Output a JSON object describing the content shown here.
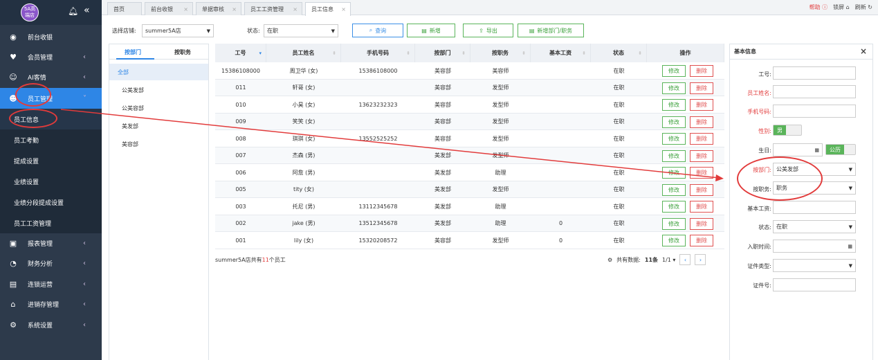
{
  "sidebar": {
    "logo_line1": "5A高",
    "logo_line2": "端店",
    "nav": [
      {
        "label": "前台收银",
        "icon": "cashier-icon"
      },
      {
        "label": "会员管理",
        "icon": "heart-icon"
      },
      {
        "label": "AI客情",
        "icon": "users-icon"
      },
      {
        "label": "员工管理",
        "icon": "user-icon"
      }
    ],
    "sub": [
      "员工信息",
      "员工考勤",
      "提成设置",
      "业绩设置",
      "业绩分段提成设置",
      "员工工资管理"
    ],
    "nav2": [
      {
        "label": "报表管理",
        "icon": "monitor-icon"
      },
      {
        "label": "财务分析",
        "icon": "pie-icon"
      },
      {
        "label": "连锁运营",
        "icon": "building-icon"
      },
      {
        "label": "进销存管理",
        "icon": "home-icon"
      },
      {
        "label": "系统设置",
        "icon": "gear-icon"
      }
    ]
  },
  "tabs": [
    "首页",
    "前台收银",
    "单据审核",
    "员工工资管理",
    "员工信息"
  ],
  "topright": {
    "help": "帮助",
    "lock": "锁屏",
    "refresh": "刷新"
  },
  "toolbar": {
    "store_label": "选择店铺:",
    "store_value": "summer5A店",
    "status_label": "状态:",
    "status_value": "在职",
    "query": "查询",
    "add": "新增",
    "export": "导出",
    "add_dept": "新增部门/职务"
  },
  "dept": {
    "tab_dept": "按部门",
    "tab_job": "按职务",
    "items": [
      "全部",
      "公美发部",
      "公美容部",
      "美发部",
      "美容部"
    ]
  },
  "table": {
    "headers": [
      "工号",
      "员工姓名",
      "手机号码",
      "按部门",
      "按职务",
      "基本工资",
      "状态",
      "操作"
    ],
    "edit": "修改",
    "delete": "删除",
    "rows": [
      [
        "15386108000",
        "周卫华 (女)",
        "15386108000",
        "美容部",
        "美容师",
        "",
        "在职"
      ],
      [
        "011",
        "轩哥 (女)",
        "",
        "美容部",
        "发型师",
        "",
        "在职"
      ],
      [
        "010",
        "小昊 (女)",
        "13623232323",
        "美容部",
        "发型师",
        "",
        "在职"
      ],
      [
        "009",
        "笑笑 (女)",
        "",
        "美容部",
        "发型师",
        "",
        "在职"
      ],
      [
        "008",
        "琪琪 (女)",
        "13552525252",
        "美容部",
        "发型师",
        "",
        "在职"
      ],
      [
        "007",
        "杰森 (男)",
        "",
        "美发部",
        "发型师",
        "",
        "在职"
      ],
      [
        "006",
        "阿詹 (男)",
        "",
        "美发部",
        "助理",
        "",
        "在职"
      ],
      [
        "005",
        "tity (女)",
        "",
        "美发部",
        "发型师",
        "",
        "在职"
      ],
      [
        "003",
        "托尼 (男)",
        "13112345678",
        "美发部",
        "助理",
        "",
        "在职"
      ],
      [
        "002",
        "jake (男)",
        "13512345678",
        "美发部",
        "助理",
        "0",
        "在职"
      ],
      [
        "001",
        "lily (女)",
        "15320208572",
        "美容部",
        "发型师",
        "0",
        "在职"
      ]
    ]
  },
  "summary": {
    "prefix": "summer5A店共有",
    "count": "11",
    "suffix": "个员工"
  },
  "pager": {
    "label": "共有数据:",
    "count": "11条",
    "page": "1/1"
  },
  "form": {
    "title": "基本信息",
    "id_label": "工号:",
    "name_label": "员工姓名:",
    "phone_label": "手机号码:",
    "gender_label": "性别:",
    "gender_value": "男",
    "birthday_label": "生日:",
    "calendar_value": "公历",
    "dept_label": "按部门:",
    "dept_value": "公美发部",
    "job_label": "按职务:",
    "job_value": "职务",
    "salary_label": "基本工资:",
    "status_label": "状态:",
    "status_value": "在职",
    "join_label": "入职时间:",
    "cert_type_label": "证件类型:",
    "cert_no_label": "证件号:"
  }
}
